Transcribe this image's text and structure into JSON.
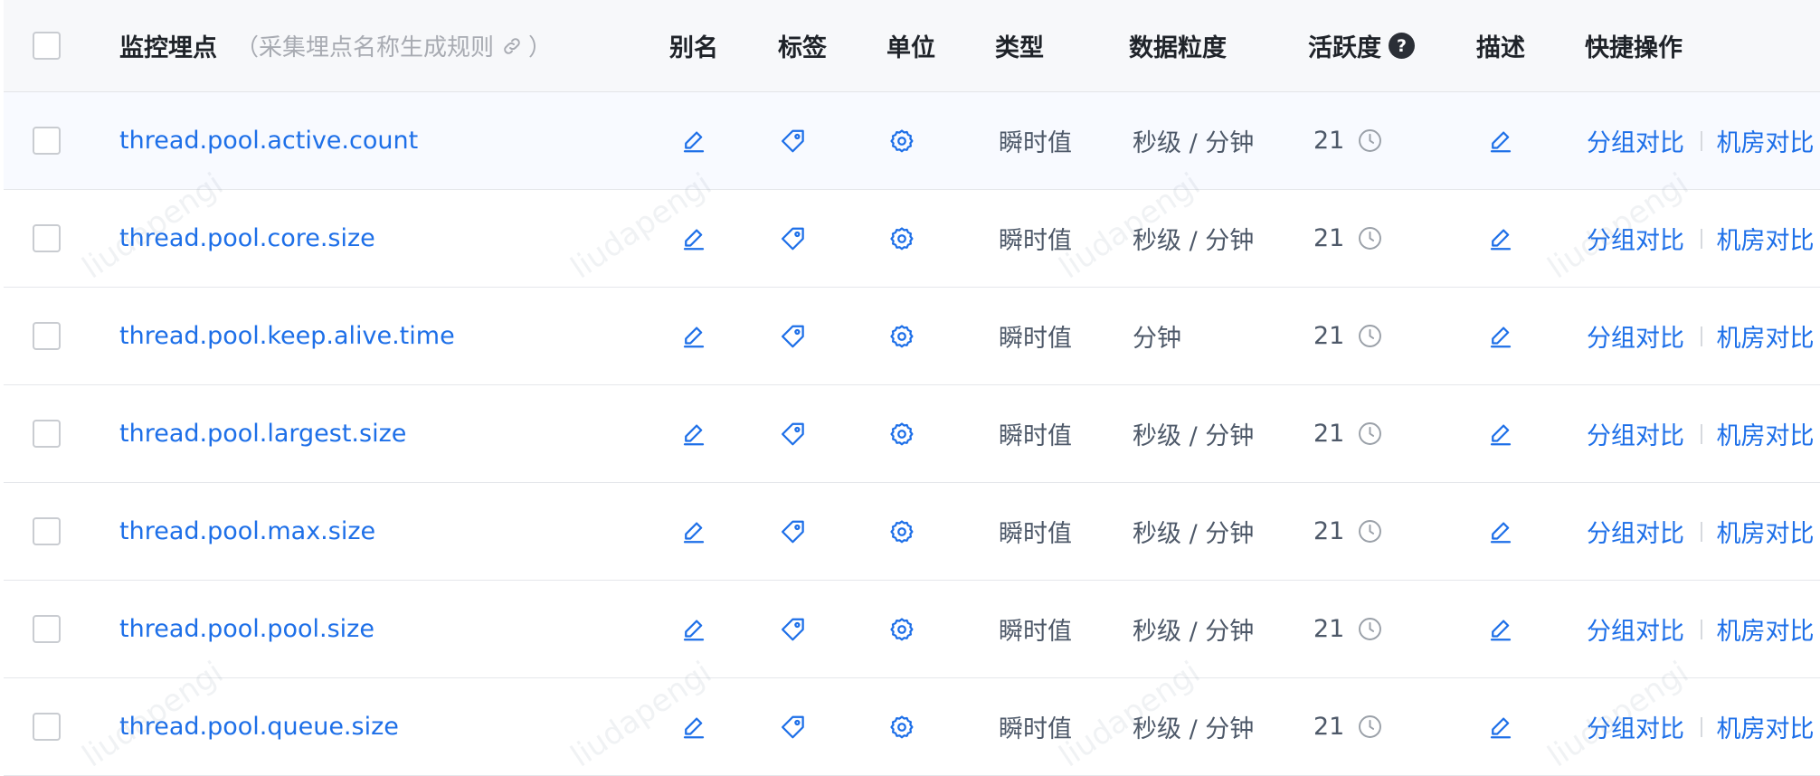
{
  "header": {
    "name_col": "监控埋点",
    "name_hint": "（采集埋点名称生成规则",
    "name_hint_end": "）",
    "alias": "别名",
    "tags": "标签",
    "unit": "单位",
    "type": "类型",
    "granularity": "数据粒度",
    "activity": "活跃度",
    "activity_help": "?",
    "desc": "描述",
    "actions": "快捷操作"
  },
  "rows": [
    {
      "name": "thread.pool.active.count",
      "type": "瞬时值",
      "granularity": "秒级 / 分钟",
      "activity": "21",
      "action1": "分组对比",
      "action2": "机房对比"
    },
    {
      "name": "thread.pool.core.size",
      "type": "瞬时值",
      "granularity": "秒级 / 分钟",
      "activity": "21",
      "action1": "分组对比",
      "action2": "机房对比"
    },
    {
      "name": "thread.pool.keep.alive.time",
      "type": "瞬时值",
      "granularity": "分钟",
      "activity": "21",
      "action1": "分组对比",
      "action2": "机房对比"
    },
    {
      "name": "thread.pool.largest.size",
      "type": "瞬时值",
      "granularity": "秒级 / 分钟",
      "activity": "21",
      "action1": "分组对比",
      "action2": "机房对比"
    },
    {
      "name": "thread.pool.max.size",
      "type": "瞬时值",
      "granularity": "秒级 / 分钟",
      "activity": "21",
      "action1": "分组对比",
      "action2": "机房对比"
    },
    {
      "name": "thread.pool.pool.size",
      "type": "瞬时值",
      "granularity": "秒级 / 分钟",
      "activity": "21",
      "action1": "分组对比",
      "action2": "机房对比"
    },
    {
      "name": "thread.pool.queue.size",
      "type": "瞬时值",
      "granularity": "秒级 / 分钟",
      "activity": "21",
      "action1": "分组对比",
      "action2": "机房对比"
    }
  ],
  "watermark": "liudapengi",
  "colors": {
    "link": "#1d6fe8",
    "header_bg": "#f7f8fa",
    "row_border": "#e5e7eb"
  }
}
